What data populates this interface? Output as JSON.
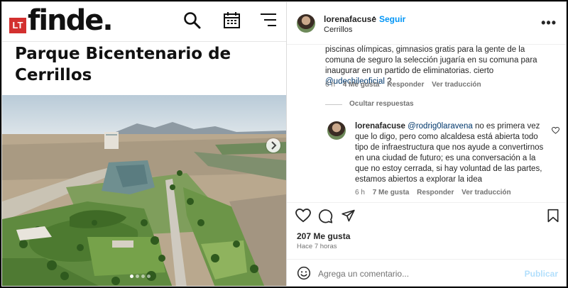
{
  "site": {
    "logo_badge": "LT",
    "logo_text": "finde.",
    "headline": "Parque Bicentenario de Cerrillos",
    "icons": [
      "search-icon",
      "calendar-icon",
      "menu-icon"
    ]
  },
  "post": {
    "username": "lorenafacuse",
    "separator": "•",
    "follow_label": "Seguir",
    "location": "Cerrillos",
    "more_label": "•••",
    "carousel": {
      "count": 4,
      "active_index": 0
    }
  },
  "comments": {
    "first": {
      "text": "piscinas olímpicas, gimnasios gratis para la gente de la comuna de seguro la selección jugaría en su comuna para inaugurar en un partido de eliminatorias. cierto ",
      "mention": "@udechileoficial",
      "text_end": " ?",
      "time": "6 h",
      "likes": "4 Me gusta",
      "reply": "Responder",
      "translate": "Ver traducción"
    },
    "hide_replies": "Ocultar respuestas",
    "reply": {
      "username": "lorenafacuse",
      "mention": "@rodrig0laravena",
      "text": " no es primera vez que lo digo, pero como alcaldesa está abierta todo tipo de infraestructura que nos ayude a convertirnos en una ciudad de futuro; es una conversación a la que no estoy cerrada, si hay voluntad de las partes, estamos abiertos a explorar la idea",
      "time": "6 h",
      "likes": "7 Me gusta",
      "reply": "Responder",
      "translate": "Ver traducción"
    }
  },
  "actions": {
    "likes": "207 Me gusta",
    "posted": "Hace 7 horas",
    "icons": [
      "heart-icon",
      "comment-icon",
      "share-icon",
      "bookmark-icon"
    ]
  },
  "compose": {
    "placeholder": "Agrega un comentario...",
    "publish_label": "Publicar"
  },
  "colors": {
    "link": "#0095f6",
    "mention": "#00376b",
    "brand_red": "#d3302f"
  }
}
